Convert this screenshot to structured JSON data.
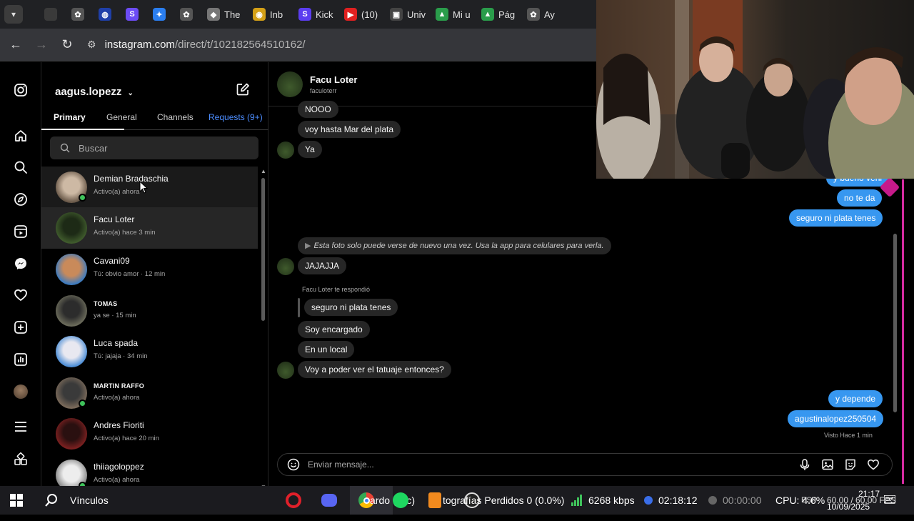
{
  "browser": {
    "tabs": [
      {
        "label": "",
        "color": "#3a3a3a",
        "glyph": ""
      },
      {
        "label": "",
        "color": "#555555",
        "glyph": "✿"
      },
      {
        "label": "",
        "color": "#1f3fa8",
        "glyph": "◍"
      },
      {
        "label": "",
        "color": "#6c4cf5",
        "glyph": "S"
      },
      {
        "label": "",
        "color": "#2a7ef0",
        "glyph": "✦"
      },
      {
        "label": "",
        "color": "#555555",
        "glyph": "✿"
      },
      {
        "label": "The",
        "color": "#777777",
        "glyph": "◆"
      },
      {
        "label": "Inb",
        "color": "#d4a017",
        "glyph": "◉"
      },
      {
        "label": "Kick",
        "color": "#5b3df0",
        "glyph": "S"
      },
      {
        "label": "(10)",
        "color": "#e02020",
        "glyph": "▶"
      },
      {
        "label": "Univ",
        "color": "#444444",
        "glyph": "▣"
      },
      {
        "label": "Mi u",
        "color": "#2a9d4b",
        "glyph": "▲"
      },
      {
        "label": "Pág",
        "color": "#2a9d4b",
        "glyph": "▲"
      },
      {
        "label": "Ay",
        "color": "#555555",
        "glyph": "✿"
      }
    ],
    "url_host": "instagram.com",
    "url_path": "/direct/t/102182564510162/"
  },
  "inbox": {
    "username": "aagus.lopezz",
    "tabs": {
      "primary": "Primary",
      "general": "General",
      "channels": "Channels",
      "requests": "Requests (9+)"
    },
    "search_placeholder": "Buscar",
    "conversations": [
      {
        "name": "Demian Bradaschia",
        "sub": "Activo(a) ahora",
        "online": true,
        "caps": false,
        "colors": [
          "#6b5a4a",
          "#cdb9a4"
        ]
      },
      {
        "name": "Facu Loter",
        "sub": "Activo(a) hace 3 min",
        "online": false,
        "caps": false,
        "colors": [
          "#3f5a2c",
          "#1d2a16"
        ]
      },
      {
        "name": "Cavani09",
        "sub": "Tú: obvio amor · 12 min",
        "online": false,
        "caps": false,
        "colors": [
          "#3d7bbf",
          "#c98a5a"
        ]
      },
      {
        "name": "TOMAS",
        "sub": "ya se · 15 min",
        "online": false,
        "caps": true,
        "colors": [
          "#6a6a5a",
          "#2c2c2c"
        ]
      },
      {
        "name": "Luca spada",
        "sub": "Tú: jajaja · 34 min",
        "online": false,
        "caps": false,
        "colors": [
          "#4f8fd6",
          "#e8e8f0"
        ]
      },
      {
        "name": "MARTIN RAFFO",
        "sub": "Activo(a) ahora",
        "online": true,
        "caps": true,
        "colors": [
          "#7a6a5a",
          "#3a3a3a"
        ]
      },
      {
        "name": "Andres Fioriti",
        "sub": "Activo(a) hace 20 min",
        "online": false,
        "caps": false,
        "colors": [
          "#7a2020",
          "#2a1010"
        ]
      },
      {
        "name": "thiiagoloppez",
        "sub": "Activo(a) ahora",
        "online": true,
        "caps": false,
        "colors": [
          "#888888",
          "#ededed"
        ]
      }
    ]
  },
  "chat": {
    "name": "Facu Loter",
    "handle": "faculoterr",
    "incoming_top": [
      "NOOO",
      "voy hasta Mar del plata",
      "Ya"
    ],
    "outgoing_top": [
      "y bueno veni",
      "no te da",
      "seguro ni plata tenes"
    ],
    "photo_note": "Esta foto solo puede verse de nuevo una vez. Usa la app para celulares para verla.",
    "msg_jajajja": "JAJAJJA",
    "reply_meta": "Facu Loter te respondió",
    "reply_quote": "seguro ni plata tenes",
    "incoming_bottom": [
      "Soy encargado",
      "En un local",
      "Voy a poder ver el tatuaje entonces?"
    ],
    "outgoing_bottom": [
      "y depende",
      "agustinalopez250504"
    ],
    "seen": "Visto Hace 1 min",
    "composer_placeholder": "Enviar mensaje..."
  },
  "taskbar": {
    "search_label": "Vínculos",
    "app_text_1": "ardo (sec)",
    "app_text_2": "tografías Perdidos 0 (0.0%)",
    "bitrate": "6268 kbps",
    "stream_time": "02:18:12",
    "rec_time": "00:00:00",
    "cpu": "CPU: 4.6%",
    "lang": "ESP",
    "fps": "60.00 / 60.00 FPS",
    "time": "21:17",
    "date": "10/09/2025"
  },
  "colors": {
    "accent": "#3797f0",
    "online": "#3fc25b",
    "requests": "#4c8dff"
  }
}
